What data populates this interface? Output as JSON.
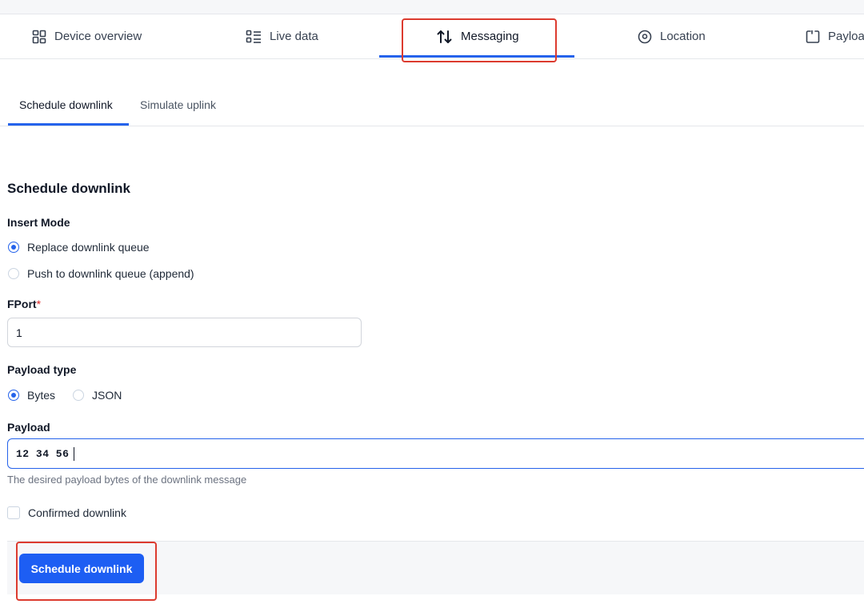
{
  "tabs": [
    {
      "label": "Device overview",
      "icon": "grid-icon"
    },
    {
      "label": "Live data",
      "icon": "list-icon"
    },
    {
      "label": "Messaging",
      "icon": "arrows-up-down-icon",
      "active": true
    },
    {
      "label": "Location",
      "icon": "location-pin-icon"
    },
    {
      "label": "Payloa",
      "icon": "code-bracket-icon"
    }
  ],
  "subtabs": [
    {
      "label": "Schedule downlink",
      "active": true
    },
    {
      "label": "Simulate uplink"
    }
  ],
  "form": {
    "title": "Schedule downlink",
    "insert_mode": {
      "label": "Insert Mode",
      "options": [
        {
          "label": "Replace downlink queue",
          "checked": true
        },
        {
          "label": "Push to downlink queue (append)",
          "checked": false
        }
      ]
    },
    "fport": {
      "label": "FPort",
      "required_mark": "*",
      "value": "1"
    },
    "payload_type": {
      "label": "Payload type",
      "options": [
        {
          "label": "Bytes",
          "checked": true
        },
        {
          "label": "JSON",
          "checked": false
        }
      ]
    },
    "payload": {
      "label": "Payload",
      "value": "12 34 56",
      "help": "The desired payload bytes of the downlink message"
    },
    "confirmed": {
      "label": "Confirmed downlink",
      "checked": false
    },
    "submit_label": "Schedule downlink"
  },
  "colors": {
    "accent": "#2563eb",
    "button": "#1d5ef3",
    "highlight": "#dc3b2f"
  }
}
